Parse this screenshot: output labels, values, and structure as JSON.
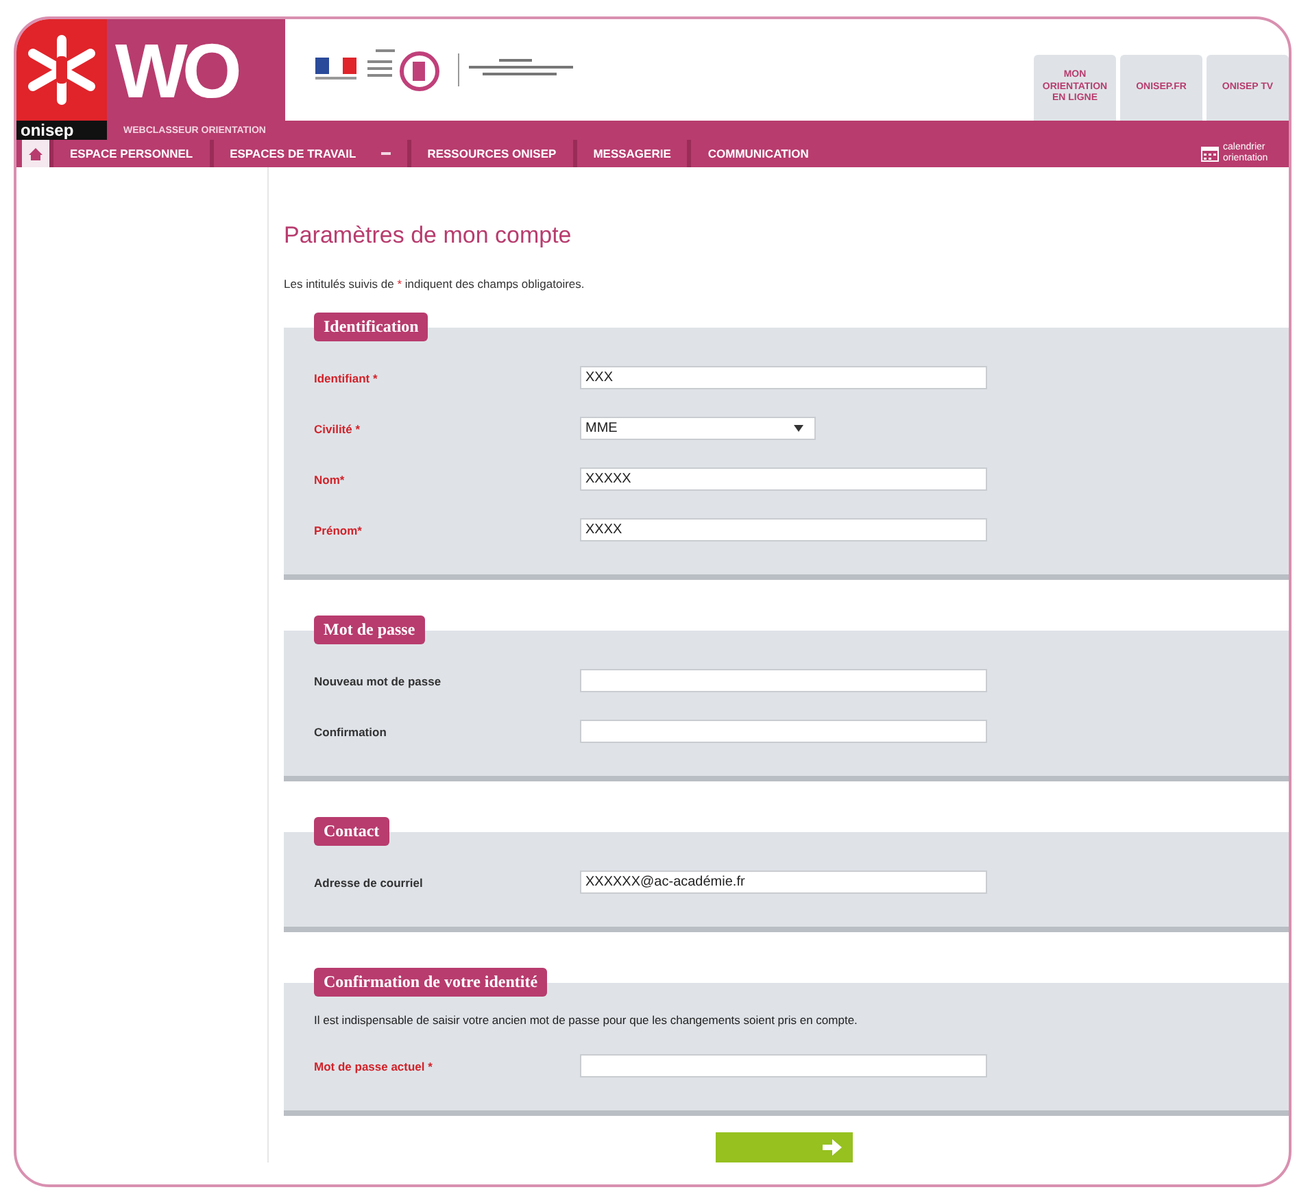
{
  "logo": {
    "mark": "WO",
    "brand": "onisep",
    "subtitle": "WEBCLASSEUR ORIENTATION"
  },
  "top_links": [
    {
      "label": "MON ORIENTATION EN LIGNE"
    },
    {
      "label": "ONISEP.FR"
    },
    {
      "label": "ONISEP TV"
    }
  ],
  "nav": [
    {
      "label": "ESPACE PERSONNEL",
      "dropdown": false
    },
    {
      "label": "ESPACES DE TRAVAIL",
      "dropdown": true
    },
    {
      "label": "RESSOURCES ONISEP",
      "dropdown": false
    },
    {
      "label": "MESSAGERIE",
      "dropdown": false
    },
    {
      "label": "COMMUNICATION",
      "dropdown": false
    }
  ],
  "calendar_link": "calendrier orientation",
  "page_title": "Paramètres de mon compte",
  "note": "Les intitulés suivis de * indiquent des champs obligatoires.",
  "sections": [
    {
      "legend": "Identification",
      "fields": [
        {
          "label": "Identifiant *",
          "required": true,
          "kind": "text",
          "value": "XXX"
        },
        {
          "label": "Civilité *",
          "required": true,
          "kind": "select",
          "value": "MME"
        },
        {
          "label": "Nom*",
          "required": true,
          "kind": "text",
          "value": "XXXXX"
        },
        {
          "label": "Prénom*",
          "required": true,
          "kind": "text",
          "value": "XXXX"
        }
      ]
    },
    {
      "legend": "Mot de passe",
      "fields": [
        {
          "label": "Nouveau mot de passe",
          "required": false,
          "kind": "text"
        },
        {
          "label": "Confirmation",
          "required": false,
          "kind": "text"
        }
      ]
    },
    {
      "legend": "Contact",
      "fields": [
        {
          "label": "Adresse de courriel",
          "required": false,
          "kind": "text",
          "value": "XXXXXX@ac-académie.fr"
        }
      ]
    },
    {
      "legend": "Confirmation de votre identité",
      "text": "Il est indispensable de saisir votre ancien mot de passe pour que les changements soient pris en compte.",
      "fields": [
        {
          "label": "Mot de passe actuel *",
          "required": true,
          "kind": "text"
        }
      ]
    }
  ]
}
